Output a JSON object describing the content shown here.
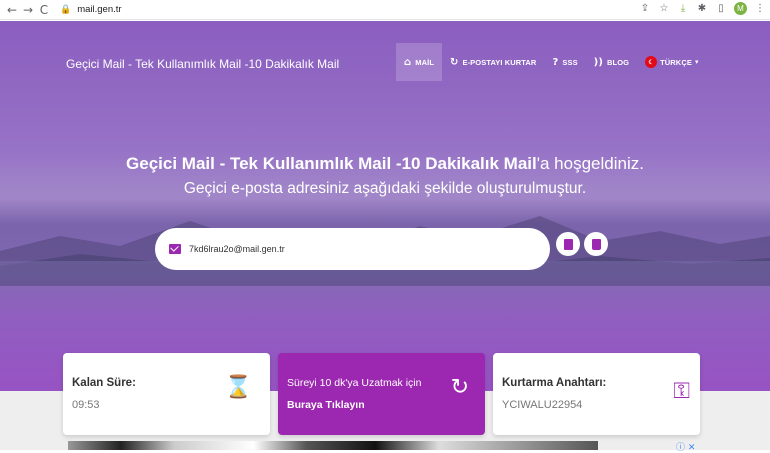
{
  "browser": {
    "url": "mail.gen.tr",
    "profile_initial": "M",
    "icons": [
      "back-icon",
      "forward-icon",
      "reload-icon",
      "lock-icon",
      "share-icon",
      "star-icon",
      "download-icon",
      "extensions-icon",
      "sidebar-icon",
      "menu-icon"
    ]
  },
  "header": {
    "site_title": "Geçici Mail - Tek Kullanımlık Mail -10 Dakikalık Mail",
    "nav": {
      "mail": "MAİL",
      "recover": "E-POSTAYI KURTAR",
      "faq": "SSS",
      "blog": "BLOG",
      "language": "TÜRKÇE"
    }
  },
  "hero": {
    "headline_bold": "Geçici Mail - Tek Kullanımlık Mail -10 Dakikalık Mail",
    "headline_rest": "'a hoşgeldiniz.",
    "subline": "Geçici e-posta adresiniz aşağıdaki şekilde oluşturulmuştur.",
    "email": "7kd6lrau2o@mail.gen.tr"
  },
  "cards": {
    "time_title": "Kalan Süre:",
    "time_value": "09:53",
    "extend_title": "Süreyi 10 dk'ya Uzatmak için",
    "extend_link": "Buraya Tıklayın",
    "key_title": "Kurtarma Anahtarı:",
    "key_value": "YCIWALU22954"
  },
  "colors": {
    "accent": "#9c27b0",
    "hero_overlay": "#9b68c6"
  }
}
